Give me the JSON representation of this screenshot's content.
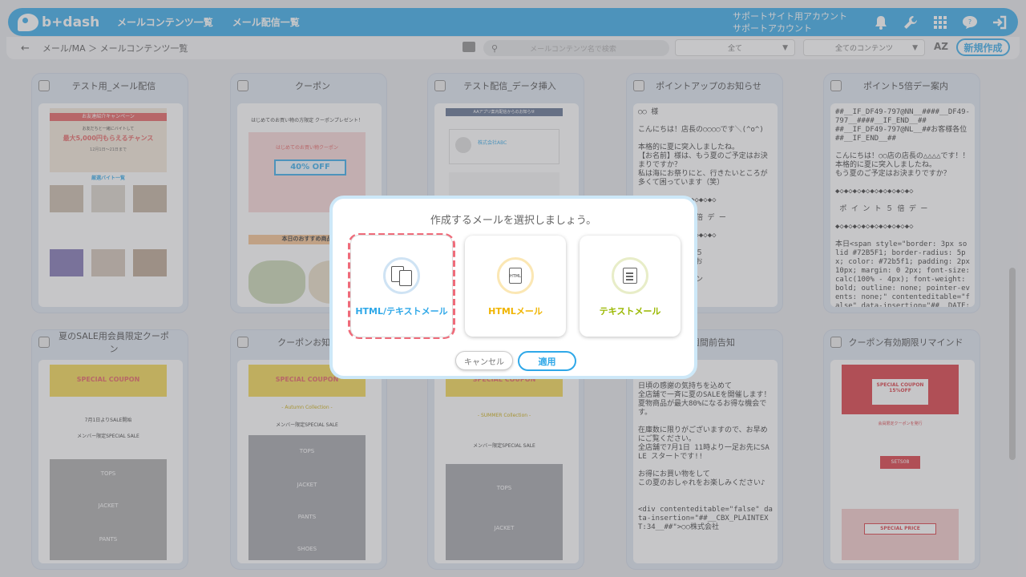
{
  "app": {
    "logo": "b+dash"
  },
  "nav": [
    {
      "label": "メールコンテンツ一覧"
    },
    {
      "label": "メール配信一覧"
    }
  ],
  "account": {
    "line1": "サポートサイト用アカウント",
    "line2": "サポートアカウント"
  },
  "breadcrumb": {
    "path": "メール/MA ＞ メールコンテンツ一覧"
  },
  "search": {
    "placeholder": "メールコンテンツ名で検索"
  },
  "filters": {
    "type": "全て",
    "contents": "全てのコンテンツ"
  },
  "sort_label": "AZ",
  "new_button": "新規作成",
  "cards": [
    {
      "title": "テスト用_メール配信",
      "kind": "html"
    },
    {
      "title": "クーポン",
      "kind": "html"
    },
    {
      "title": "テスト配信_データ挿入",
      "kind": "html"
    },
    {
      "title": "ポイントアップのお知らせ",
      "kind": "text",
      "body": "○○ 様\n\nこんにちは！店長の○○○○です＼(^o^)\n\n本格的に夏に突入しましたね。\n【お名前】様は、もう夏のご予定はお決まりですか？\n私は海にお祭りにと、行きたいところが多くて困っています（笑）\n\n◆◇◆◇◆◇◆◇◆◇◆◇◆◇◆◇◆◇\n\nポ イ ン ト ５ 倍 デ ー\n\n◆◇◆◇◆◇◆◇◆◇◆◇◆◇◆◇◆◇\n\n恒例の『ポイント５\n来店をお待ちしてお\n\nるとお得なクーポン"
    },
    {
      "title": "ポイント5倍デー案内",
      "kind": "text",
      "body": "##__IF_DF49-797@NN__####__DF49-797__####__IF_END__##\n##__IF_DF49-797@NL__##お客様各位\n##__IF_END__##\n\nこんにちは！○○店の店長の△△△△です！！\n本格的に夏に突入しましたね。\nもう夏のご予定はお決まりですか？\n\n◆◇◆◇◆◇◆◇◆◇◆◇◆◇◆◇◆◇\n\n ポ イ ン ト ５ 倍 デ ー\n\n◆◇◆◇◆◇◆◇◆◇◆◇◆◇◆◇◆◇\n\n本日<span style=\"border: 3px solid #72B5F1; border-radius: 5px; color: #72b5f1; padding: 2px 10px; margin: 0 2px; font-size: calc(100% - 4px); font-weight: bold; outline: none; pointer-events: none;\" contenteditable=\"false\" data-insertion=\"##__DATE:"
    },
    {
      "title": "夏のSALE用会員限定クーポン",
      "kind": "html"
    },
    {
      "title": "クーポンお知らせ",
      "kind": "html"
    },
    {
      "title": "",
      "kind": "html"
    },
    {
      "title": "一週間前告知",
      "kind": "text",
      "body": "SALE開催!!\n\n日頃の感謝の気持ちを込めて\n全店舗で一斉に夏のSALEを開催します！\n夏物商品が最大80%になるお得な機会です。\n\n在庫数に限りがございますので、お早めにご覧ください。\n全店舗で7月1日 11時より一足お先にSALE スタートです!!\n\nお得にお買い物をして\nこの夏のおしゃれをお楽しみください♪\n\n\n<div contenteditable=\"false\" data-insertion=\"##__CBX_PLAINTEXT:34__##\">○○株式会社"
    },
    {
      "title": "クーポン有効期限リマインド",
      "kind": "html"
    }
  ],
  "previews": {
    "c1": {
      "banner": "お友達紹介キャンペーン",
      "sub": "お友だちと一緒にバイトして",
      "amount": "最大5,000円もらえるチャンス",
      "date": "12月1日～21日まで",
      "section": "厳選バイト一覧"
    },
    "c2": {
      "heading": "はじめてのお買い物の方限定 クーポンプレゼント！",
      "coupon_title": "はじめてのお買い物クーポン",
      "discount": "40% OFF",
      "recommend": "本日のおすすめ商品"
    },
    "c3": {
      "header": "AAアプリ案内配信からのお知らせ",
      "company": "株式会社ABC"
    },
    "c6": {
      "title": "SPECIAL COUPON",
      "text": "7月1日よりSALE開始",
      "sale": "メンバー限定SPECIAL SALE",
      "tops": "TOPS",
      "jacket": "JACKET",
      "pants": "PANTS"
    },
    "c7": {
      "title": "SPECIAL COUPON",
      "collection": "- Autumn Collection -",
      "sale": "メンバー限定SPECIAL SALE",
      "tops": "TOPS",
      "jacket": "JACKET",
      "pants": "PANTS",
      "shoes": "SHOES"
    },
    "c8": {
      "title": "SPECIAL COUPON",
      "collection": "- SUMMER Collection -",
      "sale": "メンバー限定SPECIAL SALE",
      "tops": "TOPS",
      "jacket": "JACKET"
    },
    "c10": {
      "coupon": "SPECIAL COUPON 15%OFF",
      "desc": "会員限定クーポンを発行",
      "code": "SETS08",
      "price": "SPECIAL PRICE"
    }
  },
  "modal": {
    "title": "作成するメールを選択しましょう。",
    "options": [
      {
        "label": "HTML/テキストメール",
        "icon": "html-text-mail-icon",
        "color": "#2fa8e8",
        "selected": true
      },
      {
        "label": "HTMLメール",
        "icon": "html-mail-icon",
        "color": "#f0b400",
        "selected": false
      },
      {
        "label": "テキストメール",
        "icon": "text-mail-icon",
        "color": "#9ab800",
        "selected": false
      }
    ],
    "cancel": "キャンセル",
    "apply": "適用"
  },
  "colors": {
    "brand": "#2fa8e8",
    "selected_outline": "#ef6b7a"
  }
}
